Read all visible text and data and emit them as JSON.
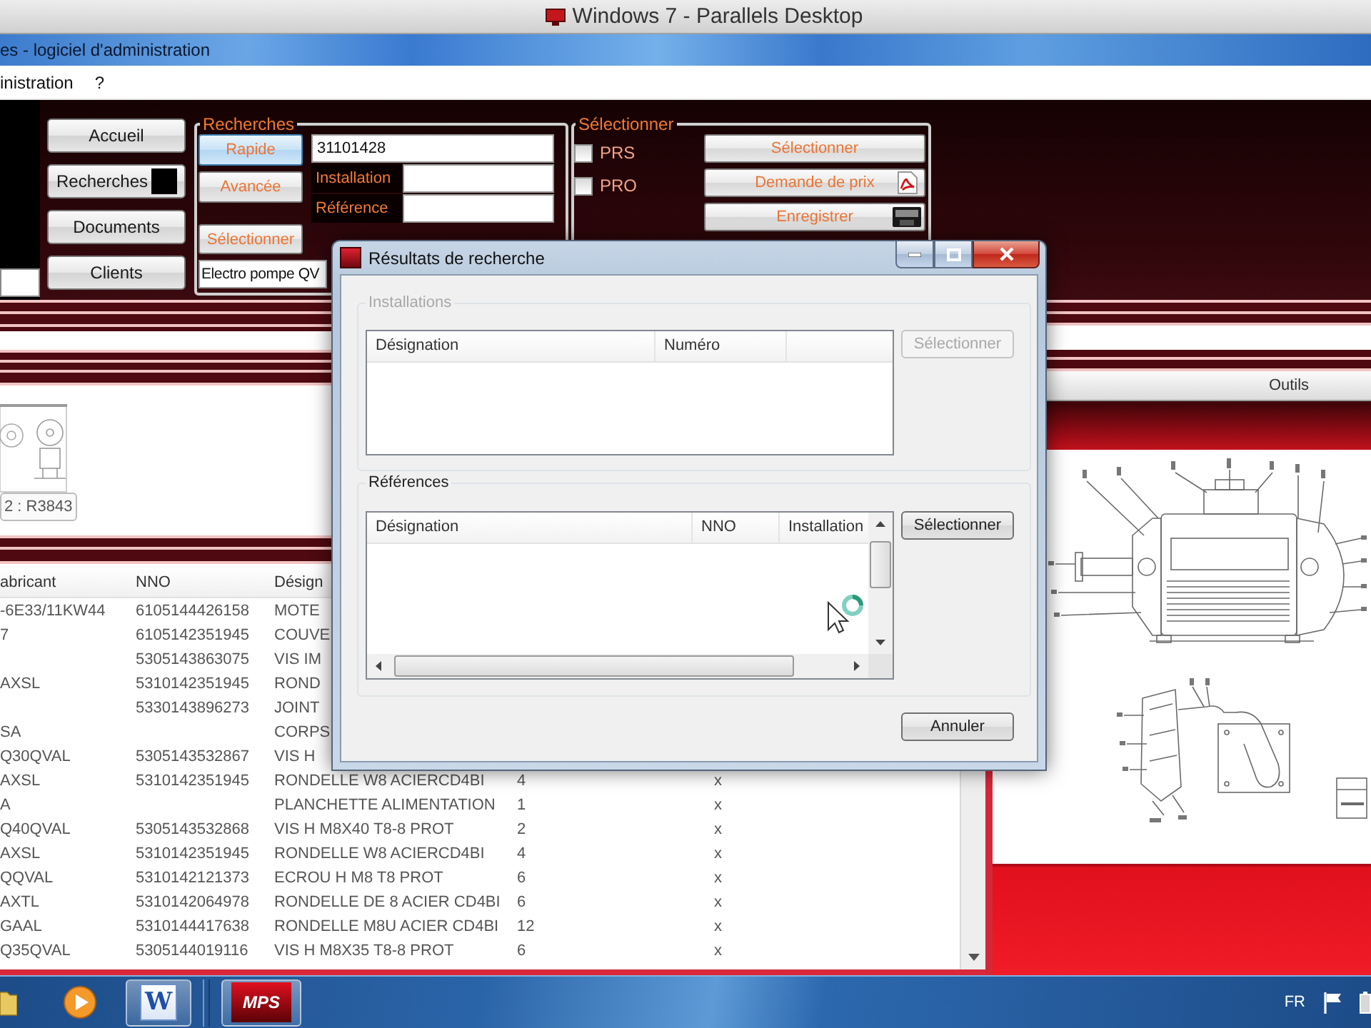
{
  "host_window": {
    "title": "Windows 7 - Parallels Desktop"
  },
  "app_window": {
    "title": "es - logiciel d'administration"
  },
  "menu": [
    {
      "label": "inistration"
    },
    {
      "label": "?"
    }
  ],
  "nav": [
    {
      "label": "Accueil",
      "selected": false
    },
    {
      "label": "Recherches",
      "selected": true
    },
    {
      "label": "Documents",
      "selected": false
    },
    {
      "label": "Clients",
      "selected": false
    }
  ],
  "search": {
    "title": "Recherches",
    "modes": [
      {
        "label": "Rapide",
        "selected": true
      },
      {
        "label": "Avancée",
        "selected": false
      }
    ],
    "query": "31101428",
    "fields": [
      {
        "label": "Installation"
      },
      {
        "label": "Référence"
      }
    ],
    "select_button": "Sélectionner",
    "result": "Electro pompe QV"
  },
  "selection": {
    "title": "Sélectionner",
    "checkboxes": [
      {
        "label": "PRS",
        "checked": false
      },
      {
        "label": "PRO",
        "checked": false
      }
    ],
    "buttons": [
      {
        "label": "Sélectionner",
        "kind": "plain"
      },
      {
        "label": "Demande de prix",
        "kind": "pdf"
      },
      {
        "label": "Enregistrer",
        "kind": "save"
      }
    ]
  },
  "thumbnail": {
    "caption": "2 : R3843"
  },
  "parts_table": {
    "columns": [
      "abricant",
      "NNO",
      "Désign"
    ],
    "rows": [
      {
        "manufacturer": "-6E33/11KW44",
        "nno": "6105144426158",
        "designation": "MOTE"
      },
      {
        "manufacturer": "7",
        "nno": "6105142351945",
        "designation": "COUVE"
      },
      {
        "nno": "5305143863075",
        "designation": "VIS IM"
      },
      {
        "manufacturer": "AXSL",
        "nno": "5310142351945",
        "designation": "ROND"
      },
      {
        "nno": "5330143896273",
        "designation": "JOINT"
      },
      {
        "manufacturer": "SA",
        "designation": "CORPS"
      },
      {
        "manufacturer": "Q30QVAL",
        "nno": "5305143532867",
        "designation": "VIS H"
      },
      {
        "manufacturer": "AXSL",
        "nno": "5310142351945",
        "designation": "RONDELLE W8 ACIERCD4BI",
        "column_4": "4",
        "column_5": "x"
      },
      {
        "manufacturer": "A",
        "designation": "PLANCHETTE ALIMENTATION",
        "column_4": "1",
        "column_5": "x"
      },
      {
        "manufacturer": "Q40QVAL",
        "nno": "5305143532868",
        "designation": "VIS H M8X40 T8-8 PROT",
        "column_4": "2",
        "column_5": "x"
      },
      {
        "manufacturer": "AXSL",
        "nno": "5310142351945",
        "designation": "RONDELLE W8 ACIERCD4BI",
        "column_4": "4",
        "column_5": "x"
      },
      {
        "manufacturer": "QQVAL",
        "nno": "5310142121373",
        "designation": "ECROU H M8 T8 PROT",
        "column_4": "6",
        "column_5": "x"
      },
      {
        "manufacturer": "AXTL",
        "nno": "5310142064978",
        "designation": "RONDELLE DE 8 ACIER CD4BI",
        "column_4": "6",
        "column_5": "x"
      },
      {
        "manufacturer": "GAAL",
        "nno": "5310144417638",
        "designation": "RONDELLE M8U ACIER CD4BI",
        "column_4": "12",
        "column_5": "x"
      },
      {
        "manufacturer": "Q35QVAL",
        "nno": "5305144019116",
        "designation": "VIS H M8X35 T8-8 PROT",
        "column_4": "6",
        "column_5": "x"
      }
    ]
  },
  "tools_panel": {
    "title": "Outils"
  },
  "dialog": {
    "title": "Résultats de recherche",
    "groups": [
      {
        "title": "Installations",
        "disabled": true,
        "scrollbars": false,
        "columns": [
          "Désignation",
          "Numéro"
        ],
        "button": {
          "label": "Sélectionner",
          "disabled": true
        }
      },
      {
        "title": "Références",
        "disabled": false,
        "scrollbars": true,
        "columns": [
          "Désignation",
          "NNO",
          "Installation"
        ],
        "button": {
          "label": "Sélectionner",
          "disabled": false
        }
      }
    ],
    "cancel": "Annuler"
  },
  "taskbar": {
    "apps": [
      {
        "kind": "folder",
        "running": false
      },
      {
        "kind": "media",
        "running": false
      },
      {
        "kind": "word",
        "label": "W",
        "running": true
      },
      {
        "kind": "mps",
        "label": "MPS",
        "running": true
      }
    ],
    "language": "FR"
  }
}
